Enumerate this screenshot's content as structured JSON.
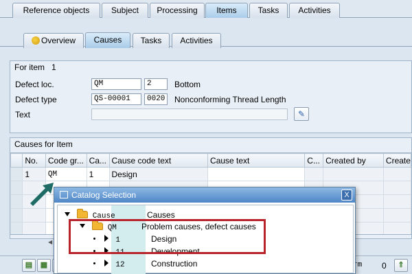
{
  "top_tabs": [
    {
      "label": "Reference objects",
      "active": false
    },
    {
      "label": "Subject",
      "active": false
    },
    {
      "label": "Processing",
      "active": false
    },
    {
      "label": "Items",
      "active": true
    },
    {
      "label": "Tasks",
      "active": false
    },
    {
      "label": "Activities",
      "active": false
    }
  ],
  "sub_tabs": [
    {
      "label": "Overview",
      "icon": "overview-icon",
      "active": false
    },
    {
      "label": "Causes",
      "active": true
    },
    {
      "label": "Tasks",
      "active": false
    },
    {
      "label": "Activities",
      "active": false
    }
  ],
  "item_group": {
    "title": "For item",
    "item_no": "1",
    "defect_loc_label": "Defect loc.",
    "defect_loc_code": "QM",
    "defect_loc_no": "2",
    "defect_loc_text": "Bottom",
    "defect_type_label": "Defect type",
    "defect_type_code": "QS-00001",
    "defect_type_no": "0020",
    "defect_type_text": "Nonconforming Thread Length",
    "text_label": "Text",
    "text_value": ""
  },
  "causes_group": {
    "title": "Causes for Item",
    "columns": [
      "No.",
      "Code gr...",
      "Ca...",
      "Cause code text",
      "Cause text",
      "C...",
      "Created by",
      "Create"
    ],
    "rows": [
      {
        "no": "1",
        "code_group": "QM",
        "cause": "1",
        "cause_code_text": "Design",
        "cause_text": "",
        "c": "",
        "created_by": "",
        "create": ""
      }
    ]
  },
  "bottom_bar": {
    "field_text": "rm",
    "count": "0"
  },
  "popup": {
    "title": "Catalog Selection",
    "close_label": "X",
    "tree": {
      "root": {
        "code": "Cause",
        "text": "Causes"
      },
      "group": {
        "code": "QM",
        "text": "Problem causes, defect causes"
      },
      "children": [
        {
          "code": "1",
          "text": "Design"
        },
        {
          "code": "11",
          "text": "Development"
        },
        {
          "code": "12",
          "text": "Construction"
        }
      ]
    }
  },
  "colors": {
    "highlight_box": "#b8232b",
    "arrow": "#1f6b66",
    "title_bar": "#4f86c6"
  }
}
